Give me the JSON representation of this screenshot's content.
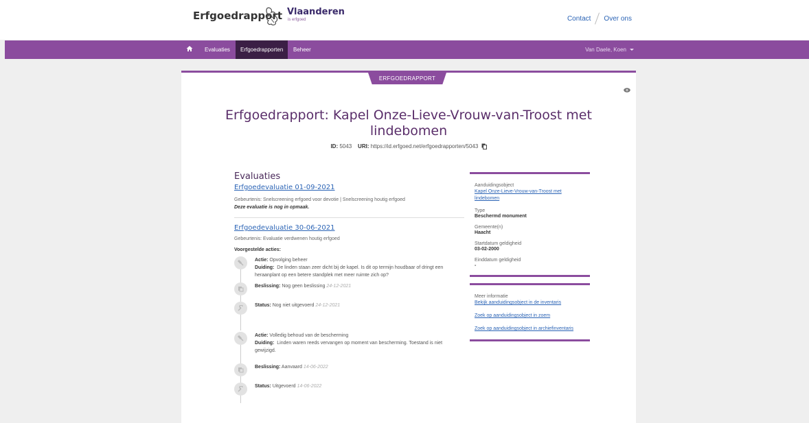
{
  "header": {
    "brand": "Erfgoedrapport",
    "logo_text": "Vlaanderen",
    "logo_sub": "is erfgoed",
    "links": [
      "Contact",
      "Over ons"
    ]
  },
  "nav": {
    "items": [
      "Evaluaties",
      "Erfgoedrapporten",
      "Beheer"
    ],
    "active": "Erfgoedrapporten",
    "user": "Van Daele, Koen"
  },
  "card": {
    "ribbon": "ERFGOEDRAPPORT",
    "title": "Erfgoedrapport: Kapel Onze-Lieve-Vrouw-van-Troost met lindebomen",
    "id_label": "ID:",
    "id_value": "5043",
    "uri_label": "URI:",
    "uri_value": "https://id.erfgoed.net/erfgoedrapporten/5043"
  },
  "evaluations": {
    "heading": "Evaluaties",
    "items": [
      {
        "title": "Erfgoedevaluatie 01-09-2021",
        "event": "Gebeurtenis: Snelscreening erfgoed voor devotie | Snelscreening houtig erfgoed",
        "note": "Deze evaluatie is nog in opmaak."
      },
      {
        "title": "Erfgoedevaluatie 30-06-2021",
        "event": "Gebeurtenis: Evaluatie verdwenen houtig erfgoed",
        "actions_label": "Voorgestelde acties:",
        "actions": [
          {
            "actie_label": "Actie:",
            "actie": "Opvolging beheer",
            "duiding_label": "Duiding:",
            "duiding": "De linden staan zeer dicht bij de kapel. Is dit op termijn houdbaar of dringt een heraanplant op een betere standplek met meer ruimte zich op?",
            "beslissing_label": "Beslissing:",
            "beslissing": "Nog geen beslissing",
            "beslissing_date": "24-12-2021",
            "status_label": "Status:",
            "status": "Nog niet uitgevoerd",
            "status_date": "24-12-2021"
          },
          {
            "actie_label": "Actie:",
            "actie": "Volledig behoud van de bescherming",
            "duiding_label": "Duiding:",
            "duiding": "Linden waren reeds vervangen op moment van bescherming. Toestand is niet gewijzigd.",
            "beslissing_label": "Beslissing:",
            "beslissing": "Aanvaard",
            "beslissing_date": "14-06-2022",
            "status_label": "Status:",
            "status": "Uitgevoerd",
            "status_date": "14-06-2022"
          }
        ]
      }
    ]
  },
  "sidebar": {
    "aanduidingsobject_label": "Aanduidingsobject",
    "aanduidingsobject": "Kapel Onze-Lieve-Vrouw-van-Troost met lindebomen",
    "type_label": "Type",
    "type": "Beschermd monument",
    "gemeente_label": "Gemeente(n)",
    "gemeente": "Haacht",
    "start_label": "Startdatum geldigheid",
    "start": "03-02-2000",
    "eind_label": "Einddatum geldigheid",
    "eind": "-",
    "meer_label": "Meer informatie",
    "links": [
      "Bekijk aanduidingsobject in de inventaris",
      "Zoek op aanduidingsobject in zoem",
      "Zoek op aanduidingsobject in archiefinventaris"
    ]
  }
}
